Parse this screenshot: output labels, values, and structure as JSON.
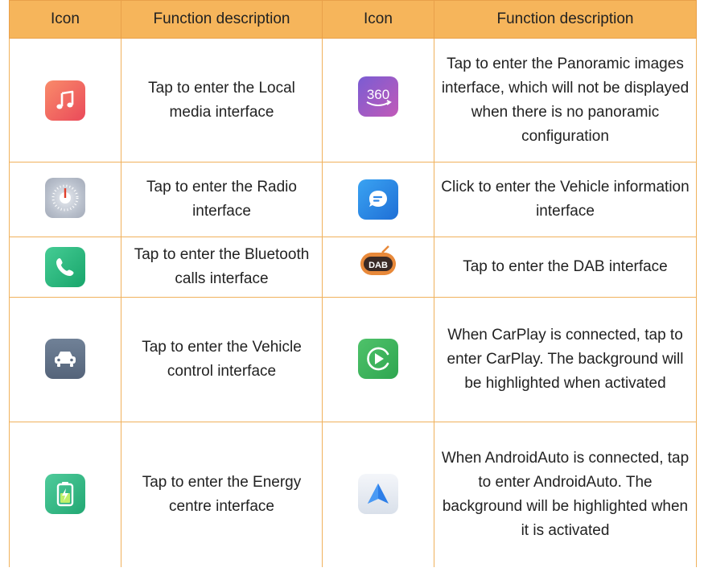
{
  "header": {
    "icon_col_1": "Icon",
    "desc_col_1": "Function description",
    "icon_col_2": "Icon",
    "desc_col_2": "Function description"
  },
  "rows": [
    {
      "left": {
        "icon": "music-note-icon",
        "text": "Tap to enter the Local media interface"
      },
      "right": {
        "icon": "panorama-360-icon",
        "icon_text": "360",
        "text": "Tap to enter the Panoramic images interface, which will not be displayed when there is no panoramic configuration"
      }
    },
    {
      "left": {
        "icon": "radio-dial-icon",
        "text": "Tap to enter the Radio interface"
      },
      "right": {
        "icon": "chat-bubble-icon",
        "text": "Click to enter the Vehicle information interface"
      }
    },
    {
      "left": {
        "icon": "phone-icon",
        "text": "Tap to enter the Bluetooth calls interface"
      },
      "right": {
        "icon": "dab-radio-icon",
        "icon_text": "DAB",
        "text": "Tap to enter the DAB interface"
      }
    },
    {
      "left": {
        "icon": "car-icon",
        "text": "Tap to enter the Vehicle control interface"
      },
      "right": {
        "icon": "carplay-icon",
        "text": "When CarPlay is connected, tap to enter CarPlay. The background will be highlighted when activated"
      }
    },
    {
      "left": {
        "icon": "battery-charging-icon",
        "text": "Tap to enter the Energy centre interface"
      },
      "right": {
        "icon": "android-auto-icon",
        "text": "When AndroidAuto is connected, tap to enter AndroidAuto. The background will be highlighted when it is activated"
      }
    }
  ],
  "colors": {
    "header_bg": "#f6b55b",
    "border": "#f0b15c"
  }
}
